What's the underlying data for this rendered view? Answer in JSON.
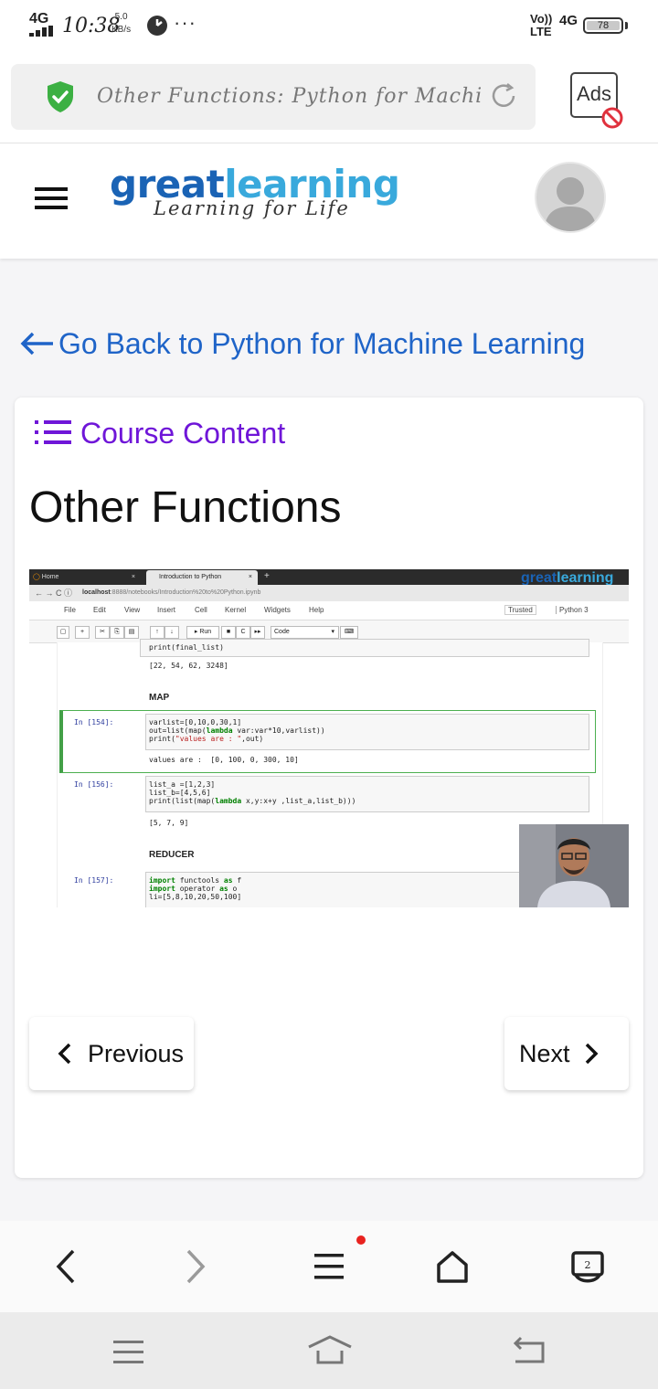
{
  "status_bar": {
    "network": "4G",
    "time": "10:38",
    "speed_value": "5.0",
    "speed_unit": "KB/s",
    "more": "···",
    "volte": "Vo)) LTE",
    "network_right": "4G",
    "battery": "78"
  },
  "browser": {
    "url_title": "Other Functions: Python for Machine ...",
    "ads_label": "Ads"
  },
  "site": {
    "logo_great": "great",
    "logo_learning": "learning",
    "tagline": "Learning for Life"
  },
  "back_link": "Go Back to Python for Machine Learning",
  "course_content": "Course Content",
  "page_title": "Other Functions",
  "video": {
    "tab1": "Home",
    "tab2": "Introduction to Python",
    "logo": "greatlearning",
    "url_host": "localhost",
    "url_path": ":8888/notebooks/Introduction%20to%20Python.ipynb",
    "menu": [
      "File",
      "Edit",
      "View",
      "Insert",
      "Cell",
      "Kernel",
      "Widgets",
      "Help"
    ],
    "trusted": "Trusted",
    "kernel": "Python 3",
    "run": "Run",
    "celltype": "Code",
    "code_print_final": "print(final_list)",
    "out_final": "[22, 54, 62, 3248]",
    "map_header": "MAP",
    "in154": "In [154]:",
    "code154_l1": "varlist=[0,10,0,30,1]",
    "code154_l2a": "out=list(map(",
    "code154_l2kw": "lambda",
    "code154_l2b": " var:var*10,varlist))",
    "code154_l3a": "print(",
    "code154_l3str": "\"values are : \"",
    "code154_l3b": ",out)",
    "out154": "values are :  [0, 100, 0, 300, 10]",
    "in156": "In [156]:",
    "code156_l1": "list_a =[1,2,3]",
    "code156_l2": "list_b=[4,5,6]",
    "code156_l3a": "print(list(map(",
    "code156_l3kw": "lambda",
    "code156_l3b": " x,y:x+y ,list_a,list_b)))",
    "out156": "[5, 7, 9]",
    "reducer_header": "REDUCER",
    "in157": "In [157]:",
    "code157_l1kw": "import",
    "code157_l1b": " functools ",
    "code157_l1kw2": "as",
    "code157_l1c": " f",
    "code157_l2kw": "import",
    "code157_l2b": " operator ",
    "code157_l2kw2": "as",
    "code157_l2c": " o",
    "code157_l3": "li=[5,8,10,20,50,100]"
  },
  "nav": {
    "previous": "Previous",
    "next": "Next"
  },
  "colors": {
    "link_blue": "#1f64c8",
    "course_purple": "#6f16d8",
    "logo_dark_blue": "#1a63b5",
    "logo_light_blue": "#39a9dc",
    "shield_green": "#3cb043"
  }
}
